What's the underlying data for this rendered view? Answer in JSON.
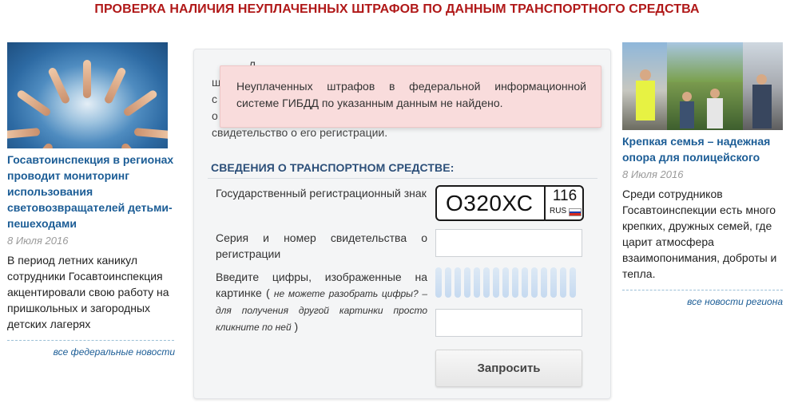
{
  "page_title": "ПРОВЕРКА НАЛИЧИЯ НЕУПЛАЧЕННЫХ ШТРАФОВ ПО ДАННЫМ ТРАНСПОРТНОГО СРЕДСТВА",
  "left_news": {
    "headline": "Госавтоинспекция в регионах проводит мониторинг использования световозвращателей детьми-пешеходами",
    "date": "8 Июля 2016",
    "body": "В период летних каникул сотрудники Госавтоинспекция акцентировали свою работу на пришкольных и загородных детских лагерях",
    "all_news_link": "все федеральные новости"
  },
  "right_news": {
    "headline": "Крепкая семья – надежная опора для полицейского",
    "date": "8 Июля 2016",
    "body": "Среди сотрудников Госавтоинспекции есть много крепких, дружных семей, где царит атмосфера взаимопонимания, доброты и тепла.",
    "all_news_link": "все новости региона"
  },
  "form": {
    "intro_lines": [
      "Д",
      "ш",
      "с",
      "о",
      "свидетельство о его регистрации."
    ],
    "alert_text": "Неуплаченных штрафов в федеральной информационной системе ГИБДД по указанным данным не найдено.",
    "section_title": "СВЕДЕНИЯ О ТРАНСПОРТНОМ СРЕДСТВЕ:",
    "plate_label": "Государственный регистрационный знак",
    "plate": {
      "number": "О320ХС",
      "region": "116",
      "country": "RUS",
      "flag_colors": [
        "#ffffff",
        "#1c3fae",
        "#d52b1e"
      ]
    },
    "cert_label": "Серия и номер свидетельства о регистрации",
    "cert_value": "",
    "captcha_label_prefix": "Введите цифры, изображенные на картинке (",
    "captcha_hint": "не можете разобрать цифры? – для получения другой картинки просто кликните по ней",
    "captcha_label_suffix": ")",
    "captcha_value": "",
    "submit_label": "Запросить"
  },
  "colors": {
    "title_red": "#b01818",
    "link_blue": "#1c5d96",
    "section_blue": "#2c4f79",
    "alert_bg": "#f9dcdc"
  }
}
